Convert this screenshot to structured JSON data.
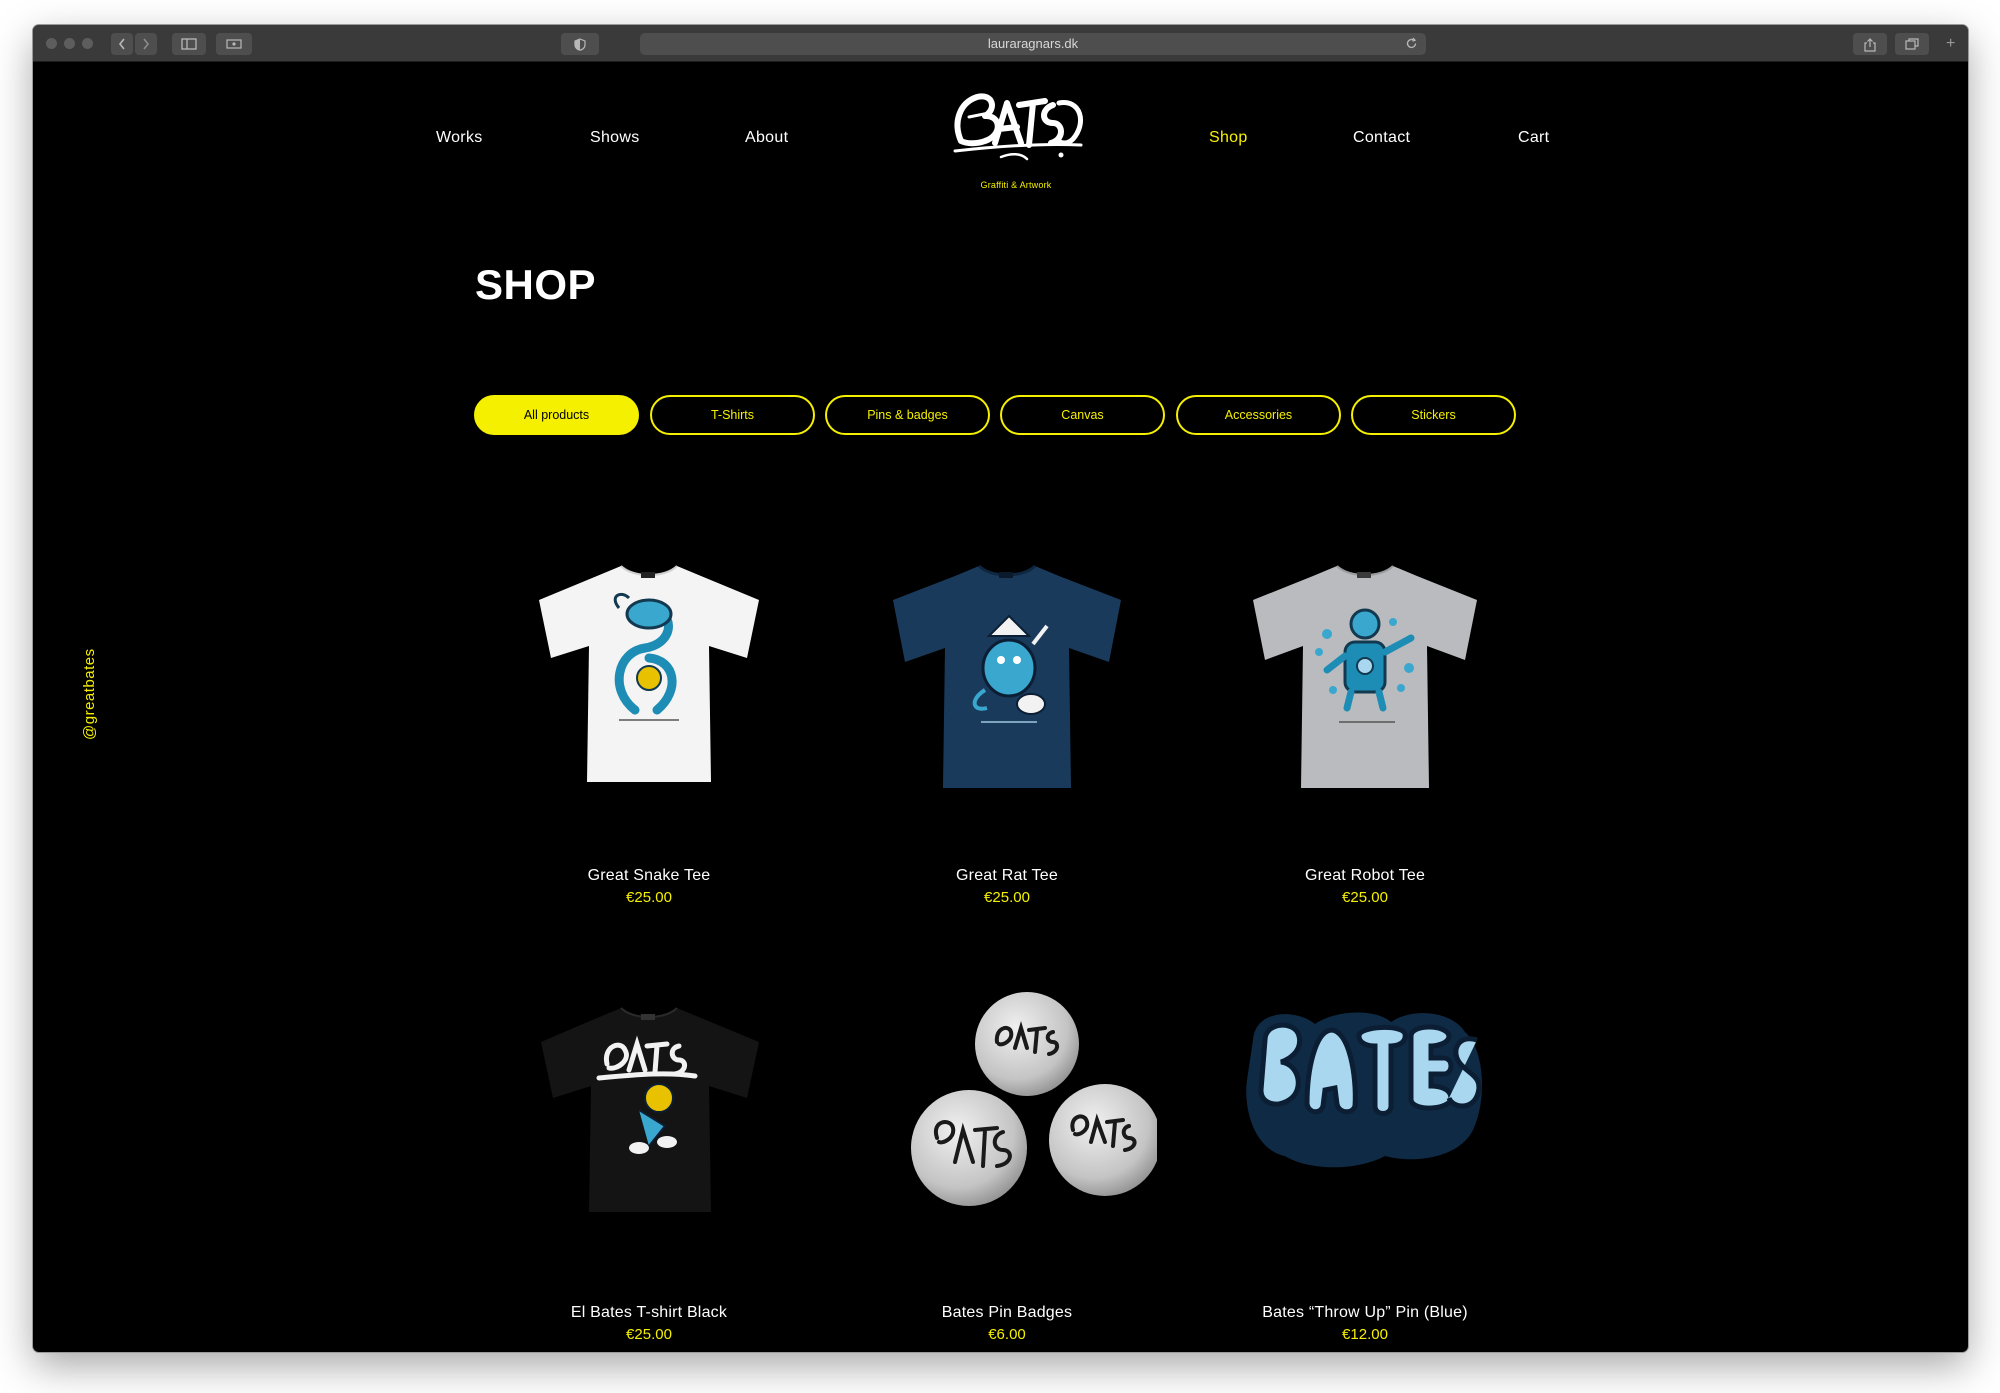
{
  "browser": {
    "url": "lauraragnars.dk"
  },
  "nav": {
    "works": "Works",
    "shows": "Shows",
    "about": "About",
    "shop": "Shop",
    "contact": "Contact",
    "cart": "Cart"
  },
  "logo": {
    "text": "BATES",
    "tagline": "Graffiti & Artwork"
  },
  "side_handle": "@greatbates",
  "page_title": "SHOP",
  "filters": [
    {
      "label": "All products",
      "active": true
    },
    {
      "label": "T-Shirts",
      "active": false
    },
    {
      "label": "Pins & badges",
      "active": false
    },
    {
      "label": "Canvas",
      "active": false
    },
    {
      "label": "Accessories",
      "active": false
    },
    {
      "label": "Stickers",
      "active": false
    }
  ],
  "products": [
    {
      "name": "Great Snake Tee",
      "price": "€25.00",
      "image": "white-tshirt-snake"
    },
    {
      "name": "Great Rat Tee",
      "price": "€25.00",
      "image": "navy-tshirt-rat"
    },
    {
      "name": "Great Robot Tee",
      "price": "€25.00",
      "image": "grey-tshirt-robot"
    },
    {
      "name": "El Bates T-shirt Black",
      "price": "€25.00",
      "image": "black-tshirt-bates"
    },
    {
      "name": "Bates Pin Badges",
      "price": "€6.00",
      "image": "pin-badges"
    },
    {
      "name": "Bates “Throw Up” Pin (Blue)",
      "price": "€12.00",
      "image": "throw-up-pin-blue"
    }
  ],
  "colors": {
    "accent": "#f5f000",
    "background": "#000000",
    "text": "#ffffff",
    "art_blue": "#3aa7cf",
    "light_blue": "#a9d7ef"
  }
}
